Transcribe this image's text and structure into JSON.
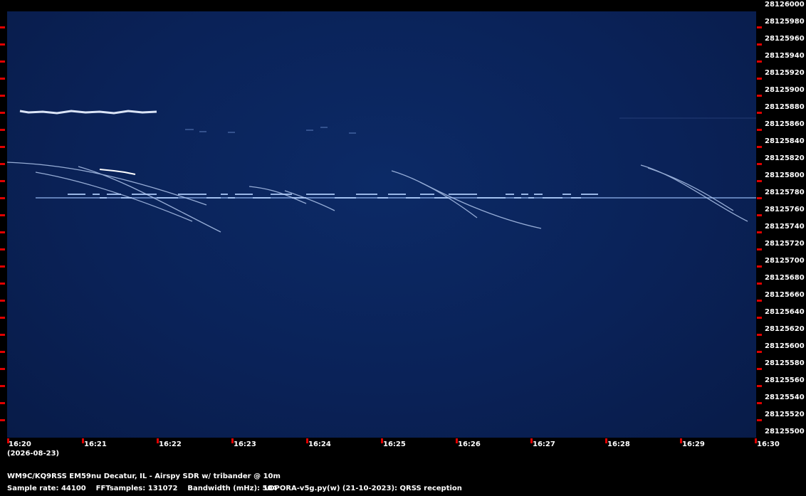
{
  "spectrogram": {
    "frequency_axis": {
      "labels": [
        "28126000",
        "28125980",
        "28125960",
        "28125940",
        "28125920",
        "28125900",
        "28125880",
        "28125860",
        "28125840",
        "28125820",
        "28125800",
        "28125780",
        "28125760",
        "28125740",
        "28125720",
        "28125700",
        "28125680",
        "28125660",
        "28125640",
        "28125620",
        "28125600",
        "28125580",
        "28125560",
        "28125540",
        "28125520",
        "28125500"
      ]
    },
    "time_axis": {
      "labels": [
        "16:20",
        "16:21",
        "16:22",
        "16:23",
        "16:24",
        "16:25",
        "16:26",
        "16:27",
        "16:28",
        "16:29",
        "16:30"
      ],
      "date": "(2026-08-23)"
    },
    "colors": {
      "background": "#0a2258",
      "signal": "#cfe0ff",
      "tick": "#e00000"
    }
  },
  "footer": {
    "station": "WM9C/KQ9RSS EM59nu Decatur, IL - Airspy SDR w/ tribander @ 10m",
    "params": "Sample rate: 44100    FFTsamples: 131072    Bandwidth (mHz): 504",
    "software": "LOPORA-v5g.py(w) (21-10-2023): QRSS reception"
  }
}
